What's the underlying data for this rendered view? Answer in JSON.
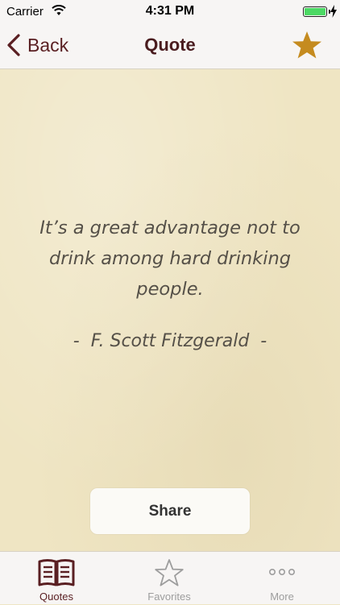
{
  "status_bar": {
    "carrier": "Carrier",
    "time": "4:31 PM",
    "battery_level": 1.0,
    "charging": true
  },
  "nav": {
    "back_label": "Back",
    "title": "Quote",
    "favorite_color": "#c58b1f"
  },
  "quote": {
    "text": "It’s a great advantage not to drink among hard drinking people.",
    "author": "-  F. Scott Fitzgerald  -"
  },
  "share_label": "Share",
  "tabs": [
    {
      "label": "Quotes",
      "icon": "book-icon",
      "active": true
    },
    {
      "label": "Favorites",
      "icon": "star-outline-icon",
      "active": false
    },
    {
      "label": "More",
      "icon": "more-dots-icon",
      "active": false
    }
  ],
  "colors": {
    "accent": "#5a1f22",
    "background": "#efe5c3",
    "star": "#c58b1f",
    "inactive": "#9d9d9d"
  }
}
